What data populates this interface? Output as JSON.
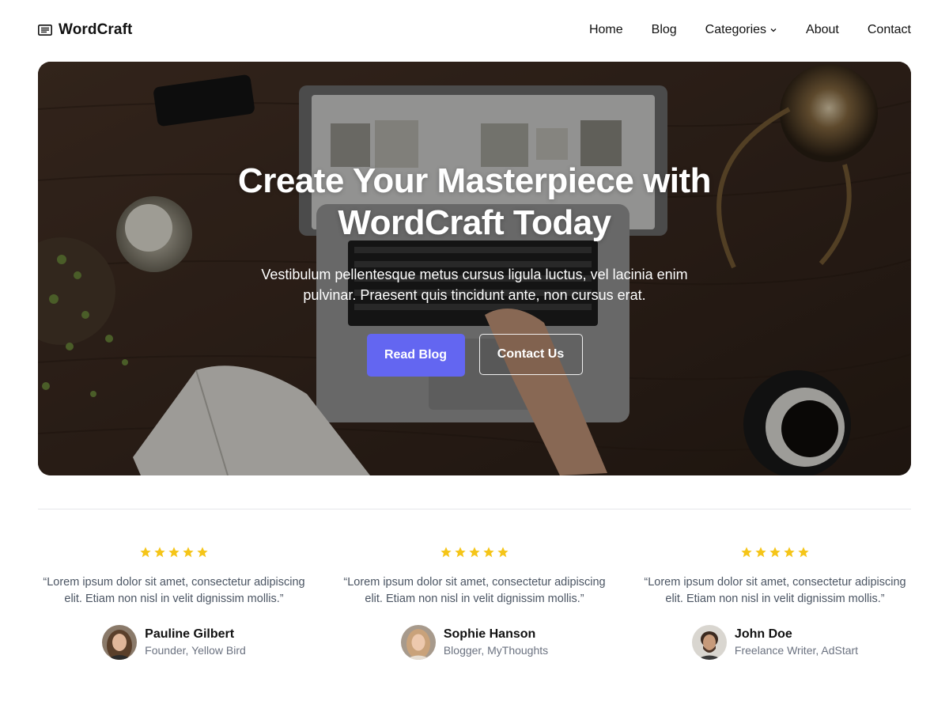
{
  "header": {
    "brand": "WordCraft",
    "brand_icon": "newspaper-icon",
    "nav": [
      {
        "label": "Home"
      },
      {
        "label": "Blog"
      },
      {
        "label": "Categories",
        "has_dropdown": true
      },
      {
        "label": "About"
      },
      {
        "label": "Contact"
      }
    ]
  },
  "hero": {
    "title": "Create Your Masterpiece with WordCraft Today",
    "subtitle": "Vestibulum pellentesque metus cursus ligula luctus, vel lacinia enim pulvinar. Praesent quis tincidunt ante, non cursus erat.",
    "primary_button": "Read Blog",
    "secondary_button": "Contact Us"
  },
  "testimonials": [
    {
      "rating": 5,
      "quote": "“Lorem ipsum dolor sit amet, consectetur adipiscing elit. Etiam non nisl in velit dignissim mollis.”",
      "name": "Pauline Gilbert",
      "role": "Founder, Yellow Bird"
    },
    {
      "rating": 5,
      "quote": "“Lorem ipsum dolor sit amet, consectetur adipiscing elit. Etiam non nisl in velit dignissim mollis.”",
      "name": "Sophie Hanson",
      "role": "Blogger, MyThoughts"
    },
    {
      "rating": 5,
      "quote": "“Lorem ipsum dolor sit amet, consectetur adipiscing elit. Etiam non nisl in velit dignissim mollis.”",
      "name": "John Doe",
      "role": "Freelance Writer, AdStart"
    }
  ],
  "colors": {
    "accent": "#6366f1",
    "star": "#f5c518",
    "text_dark": "#111111",
    "text_muted": "#6b7280"
  }
}
